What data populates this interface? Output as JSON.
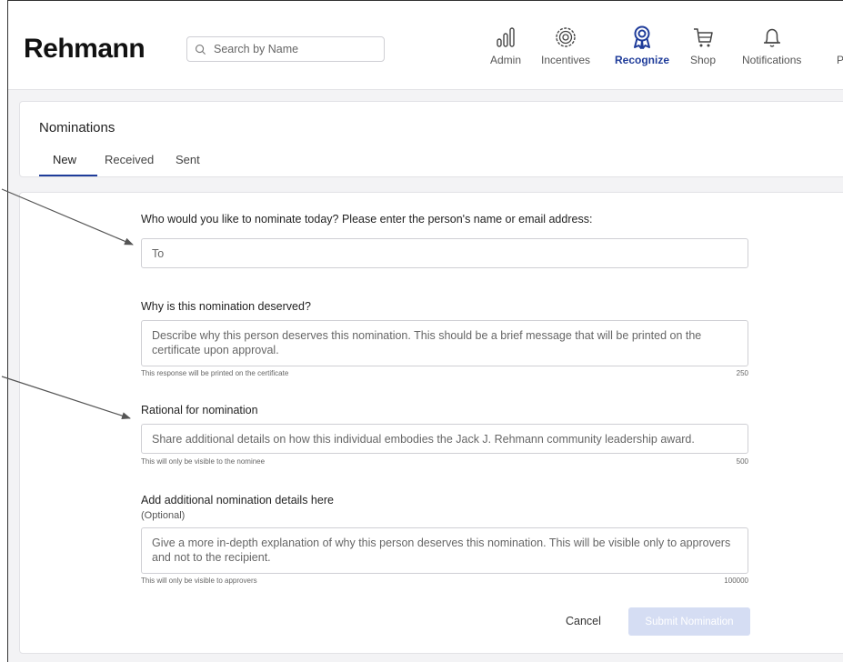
{
  "app": {
    "logo": "Rehmann"
  },
  "search": {
    "placeholder": "Search by Name"
  },
  "nav": {
    "items": [
      {
        "label": "Admin",
        "icon": "bar-chart-icon",
        "active": false
      },
      {
        "label": "Incentives",
        "icon": "target-icon",
        "active": false
      },
      {
        "label": "Recognize",
        "icon": "award-ribbon-icon",
        "active": true
      },
      {
        "label": "Shop",
        "icon": "shopping-cart-icon",
        "active": false
      },
      {
        "label": "Notifications",
        "icon": "bell-icon",
        "active": false
      },
      {
        "label": "Pr",
        "icon": "profile-icon",
        "active": false
      }
    ]
  },
  "page": {
    "title": "Nominations",
    "tabs": [
      {
        "label": "New",
        "active": true
      },
      {
        "label": "Received",
        "active": false
      },
      {
        "label": "Sent",
        "active": false
      }
    ]
  },
  "form": {
    "to": {
      "question": "Who would you like to nominate today? Please enter the person's name or email address:",
      "placeholder": "To"
    },
    "reason": {
      "question": "Why is this nomination deserved?",
      "placeholder": "Describe why this person deserves this nomination. This should be a brief message that will be printed on the certificate upon approval.",
      "hint": "This response will be printed on the certificate",
      "max_chars": "250"
    },
    "rationale": {
      "question": "Rational for nomination",
      "placeholder": "Share additional details on how this individual embodies the Jack J. Rehmann community leadership award.",
      "hint": "This will only be visible to the nominee",
      "max_chars": "500"
    },
    "details": {
      "question": "Add additional nomination details here",
      "optional": "(Optional)",
      "placeholder": "Give a more in-depth explanation of why this person deserves this nomination. This will be visible only to approvers and not to the recipient.",
      "hint": "This will only be visible to approvers",
      "max_chars": "100000"
    },
    "cancel_label": "Cancel",
    "submit_label": "Submit Nomination"
  },
  "colors": {
    "accent": "#1f3c9a",
    "submit_disabled_bg": "#d5ddf3",
    "background": "#f3f3f5"
  }
}
